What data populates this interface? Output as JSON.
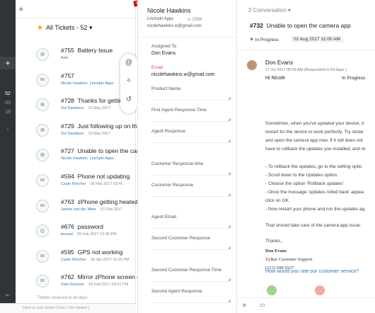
{
  "rail": {
    "plus": "+",
    "counts": [
      "52",
      "03",
      "19"
    ]
  },
  "list": {
    "header": "All Tickets - 52",
    "tickets": [
      {
        "id": "#755",
        "subject": "Battery Issue",
        "agent": "Axin",
        "tag": "",
        "date": "",
        "av": "⊕"
      },
      {
        "id": "#757",
        "subject": "",
        "agent": "Nicole Hawkins",
        "tag": "Linchpin Apps",
        "date": "",
        "av": "✉"
      },
      {
        "id": "#728",
        "subject": "Thanks for getting",
        "agent": "Sol Davidson",
        "tag": "",
        "date": "12 May 2017",
        "av": "⊕"
      },
      {
        "id": "#729",
        "subject": "Just following up on the",
        "agent": "Sol Davidson",
        "tag": "",
        "date": "12 May 2017",
        "av": "⊕"
      },
      {
        "id": "#727",
        "subject": "Unable to open the cam",
        "agent": "Nicole Hawkins",
        "tag": "Linchpin Apps",
        "date": "",
        "av": "⊕"
      },
      {
        "id": "#594",
        "subject": "Phone not updating",
        "agent": "Casie Fletcher",
        "tag": "",
        "date": "06 Mar 2017 03:45",
        "av": "✉"
      },
      {
        "id": "#763",
        "subject": "zPhone getting heated",
        "agent": "James van der Meer",
        "tag": "",
        "date": "07 Feb 2017",
        "av": "✉"
      },
      {
        "id": "#676",
        "subject": "password",
        "agent": "prasad",
        "tag": "",
        "date": "09 Feb 2017 10:36 PM",
        "av": "◎"
      },
      {
        "id": "#595",
        "subject": "GPS not working",
        "agent": "Casie Fletcher",
        "tag": "",
        "date": "18 Jan 2017 11:02 PM",
        "av": "✉"
      },
      {
        "id": "#762",
        "subject": "Mirror zPhone screen on",
        "agent": "Sam Rossner",
        "tag": "",
        "date": "03 Feb 2017 03:51 PM",
        "av": "✉"
      }
    ],
    "footer": "Tickets received in all days",
    "chat_placeholder": "Here is your Smart Chat ( Ctrl+Space )"
  },
  "props": {
    "beta": "BETA",
    "contact_name": "Nicole Hawkins",
    "account": "Linchpin Apps",
    "crm": "CRM",
    "email": "nicolehawkins.w@gmail.com",
    "fields": [
      {
        "label": "Assigned To",
        "value": "Don Evans",
        "red": false
      },
      {
        "label": "Email",
        "value": "nicolehawkins.w@gmail.com",
        "red": true
      },
      {
        "label": "Product Name",
        "value": "",
        "red": false
      },
      {
        "label": "First Agent Response Time",
        "value": "",
        "red": false
      },
      {
        "label": "Agent Response",
        "value": "",
        "red": false
      },
      {
        "label": "Customer Response time",
        "value": "",
        "red": false
      },
      {
        "label": "Customer Response",
        "value": "",
        "red": false
      },
      {
        "label": "Agent Email",
        "value": "",
        "red": false
      },
      {
        "label": "Second Customer Response",
        "value": "",
        "red": false
      },
      {
        "label": "Second Customer Response Time",
        "value": "",
        "red": false
      },
      {
        "label": "Second Agent Response",
        "value": "",
        "red": false
      }
    ]
  },
  "conv": {
    "tab": "2 Conversation",
    "ticket_id": "#732",
    "subject": "Unable to open the camera app",
    "status": "In Progress",
    "date": "02 Aug 2017 12:00 AM",
    "from": "Don Evans",
    "sent": "17 Jul 2017 05:09 AM (Responded in 63 days )",
    "greeting": "Hi Nicole",
    "msg_status": "In Progress",
    "body": [
      "Sometimes, when you've updated your device, it",
      "restart for the device to work perfectly. Try restar",
      "and open the camera app now. If it still does not",
      "have to rollback the updates you installed, and re",
      "- To rollback the updates, go to the setting optio",
      "- Scroll down to the Updates option",
      "- Choose the option 'Rollback updates'",
      "- Once the message 'updates rolled back' appea",
      "click on OK.",
      "- Now restart your phone and run the updates ag",
      "That should take care of the camera app issue.",
      "Thanks,"
    ],
    "signature": [
      "Don Evans",
      "Zylker Customer Support",
      "(213) 699-5537"
    ],
    "rating": "How would you rate our customer service?"
  }
}
